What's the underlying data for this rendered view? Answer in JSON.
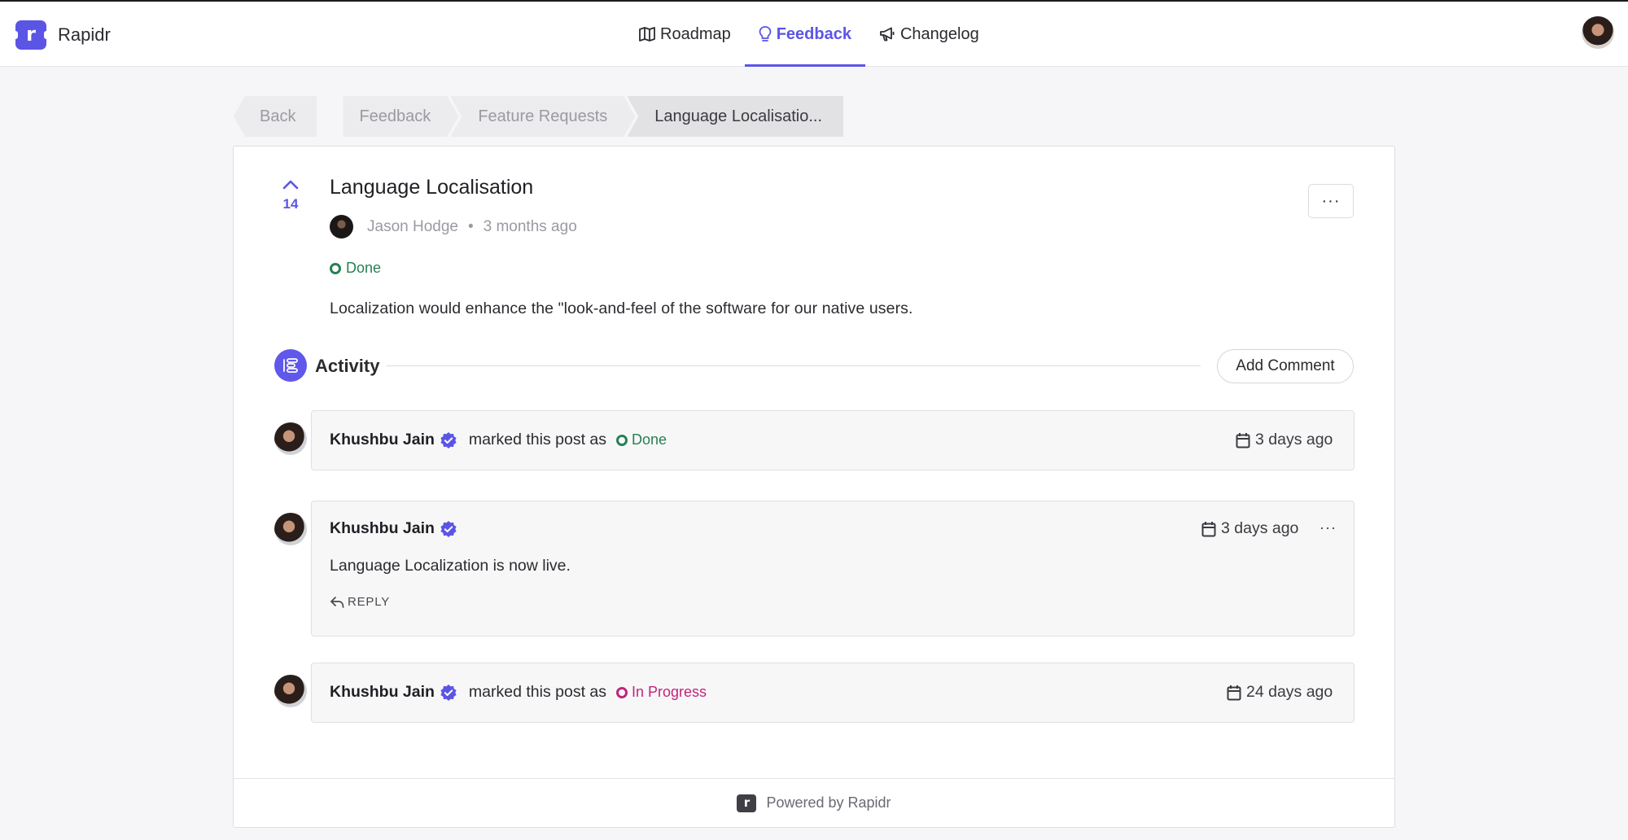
{
  "brand": {
    "name": "Rapidr",
    "logo_letter": "r"
  },
  "nav": {
    "items": [
      {
        "label": "Roadmap",
        "icon": "map-icon"
      },
      {
        "label": "Feedback",
        "icon": "lightbulb-icon",
        "active": true
      },
      {
        "label": "Changelog",
        "icon": "megaphone-icon"
      }
    ]
  },
  "breadcrumb": {
    "back": "Back",
    "items": [
      "Feedback",
      "Feature Requests",
      "Language Localisatio..."
    ]
  },
  "post": {
    "votes": "14",
    "title": "Language Localisation",
    "author": "Jason Hodge",
    "separator": "•",
    "time": "3 months ago",
    "status": "Done",
    "body": "Localization would enhance the \"look-and-feel of the software for our native users.",
    "more": "···"
  },
  "activity": {
    "label": "Activity",
    "add_comment": "Add Comment",
    "entries": [
      {
        "user": "Khushbu Jain",
        "action": "marked this post as",
        "status": "Done",
        "time": "3 days ago"
      },
      {
        "user": "Khushbu Jain",
        "comment": "Language Localization is now live.",
        "time": "3 days ago",
        "reply": "REPLY",
        "more": "···"
      },
      {
        "user": "Khushbu Jain",
        "action": "marked this post as",
        "status": "In Progress",
        "time": "24 days ago"
      }
    ]
  },
  "footer": {
    "text": "Powered by Rapidr",
    "logo_letter": "r"
  },
  "colors": {
    "accent": "#5b55e6",
    "done": "#278052",
    "in_progress": "#c0267a"
  }
}
